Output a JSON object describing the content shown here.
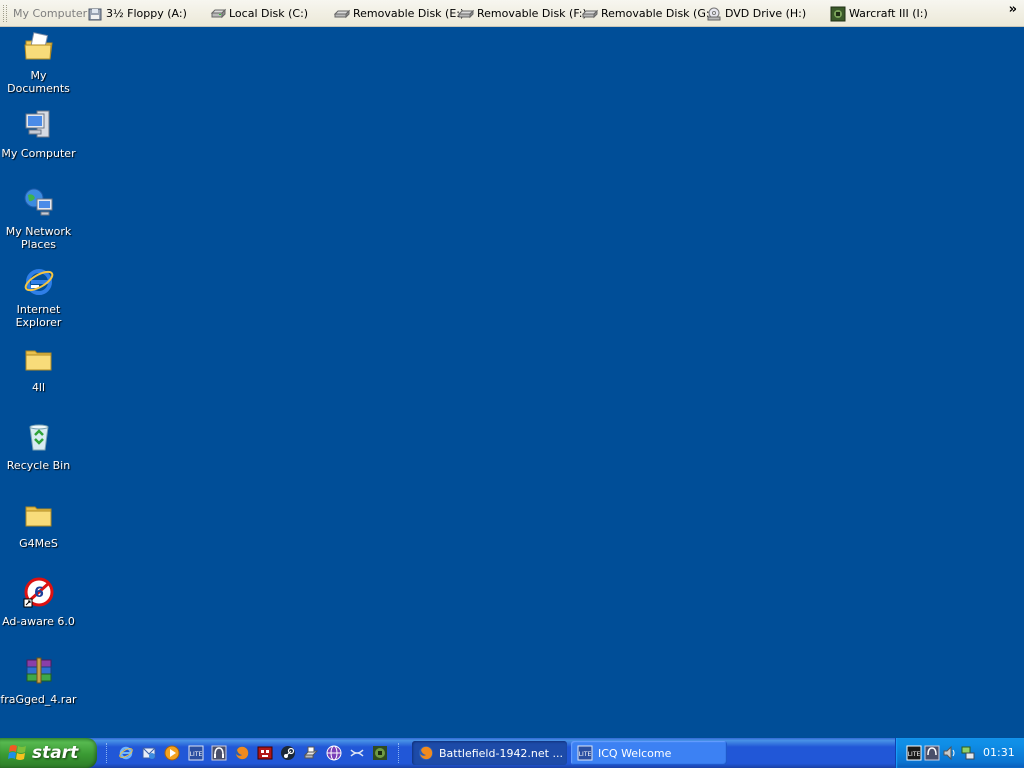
{
  "toolbar": {
    "title": "My Computer",
    "drives": [
      {
        "label": "3½ Floppy (A:)",
        "icon": "floppy-drive-icon"
      },
      {
        "label": "Local Disk (C:)",
        "icon": "hard-disk-icon"
      },
      {
        "label": "Removable Disk (E:)",
        "icon": "removable-disk-icon"
      },
      {
        "label": "Removable Disk (F:)",
        "icon": "removable-disk-icon"
      },
      {
        "label": "Removable Disk (G:)",
        "icon": "removable-disk-icon"
      },
      {
        "label": "DVD Drive (H:)",
        "icon": "dvd-drive-icon"
      },
      {
        "label": "Warcraft III (I:)",
        "icon": "warcraft-drive-icon"
      }
    ],
    "chevron": "»"
  },
  "desktop": {
    "background_color": "#004e98",
    "icons": [
      {
        "label": "My Documents",
        "icon": "my-documents-icon"
      },
      {
        "label": "My Computer",
        "icon": "my-computer-icon"
      },
      {
        "label": "My Network Places",
        "icon": "network-places-icon"
      },
      {
        "label": "Internet Explorer",
        "icon": "internet-explorer-icon"
      },
      {
        "label": "4ll",
        "icon": "folder-icon"
      },
      {
        "label": "Recycle Bin",
        "icon": "recycle-bin-icon"
      },
      {
        "label": "G4MeS",
        "icon": "folder-icon"
      },
      {
        "label": "Ad-aware 6.0",
        "icon": "ad-aware-icon"
      },
      {
        "label": "fraGged_4.rar",
        "icon": "winrar-archive-icon"
      }
    ]
  },
  "taskbar": {
    "start_label": "start",
    "quick_launch": [
      "internet-explorer-icon",
      "outlook-express-icon",
      "media-player-icon",
      "icq-lite-icon",
      "headset-icon",
      "firefox-icon",
      "game-icon",
      "steam-icon",
      "scanner-icon",
      "globe-app-icon",
      "link-icon",
      "warcraft-icon"
    ],
    "tasks": [
      {
        "label": "Battlefield-1942.net ...",
        "icon": "firefox-icon",
        "state": "active"
      },
      {
        "label": "ICQ Welcome",
        "icon": "icq-lite-icon",
        "state": "inactive"
      }
    ],
    "tray_icons": [
      "icq-lite-tray-icon",
      "headset-tray-icon",
      "speaker-tray-icon",
      "network-tray-icon"
    ],
    "clock": "01:31"
  }
}
